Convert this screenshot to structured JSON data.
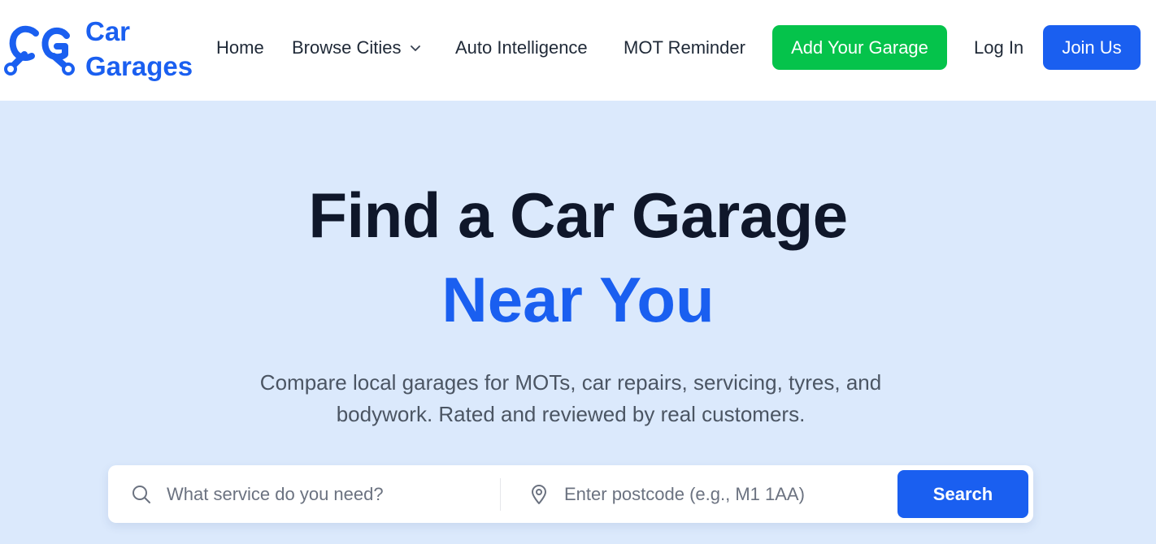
{
  "brand": {
    "logo_mark": "CG wrench logo",
    "name_line1": "Car",
    "name_line2": "Garages",
    "color": "#1a5ff0"
  },
  "nav": {
    "home": "Home",
    "browse_cities": "Browse Cities",
    "auto_intelligence": "Auto Intelligence",
    "mot_reminder": "MOT Reminder",
    "add_garage": "Add Your Garage",
    "log_in": "Log In",
    "join_us": "Join Us"
  },
  "hero": {
    "title_line1": "Find a Car Garage",
    "title_line2": "Near You",
    "subtitle": "Compare local garages for MOTs, car repairs, servicing, tyres, and bodywork. Rated and reviewed by real customers."
  },
  "search": {
    "service_placeholder": "What service do you need?",
    "service_value": "",
    "postcode_placeholder": "Enter postcode (e.g., M1 1AA)",
    "postcode_value": "",
    "button": "Search"
  },
  "icons": {
    "service": "search-icon",
    "postcode": "location-pin-icon",
    "browse_cities": "chevron-down-icon"
  },
  "colors": {
    "accent": "#1a5ff0",
    "green": "#05c34b",
    "hero_bg": "#dbe9fc",
    "heading": "#0f172a"
  }
}
